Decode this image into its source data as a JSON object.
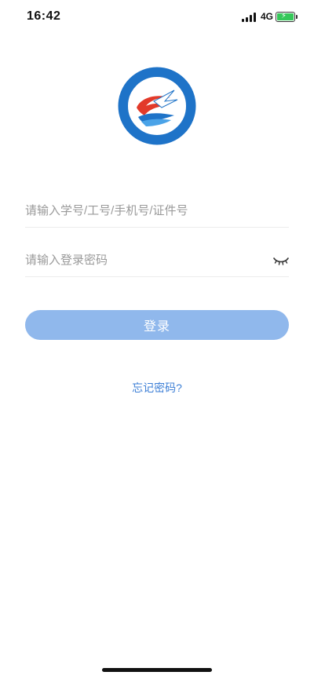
{
  "status_bar": {
    "time": "16:42",
    "network": "4G",
    "battery_icon": "battery-charging-icon",
    "signal_icon": "signal-icon"
  },
  "logo": {
    "icon": "college-logo-icon",
    "colors": {
      "blue": "#1e73c8",
      "red": "#e23a2a",
      "white": "#ffffff"
    }
  },
  "form": {
    "username_placeholder": "请输入学号/工号/手机号/证件号",
    "password_placeholder": "请输入登录密码",
    "toggle_visibility_icon": "eye-closed-icon"
  },
  "login_button": {
    "label": "登录",
    "color": "#90b8ec"
  },
  "forgot_password": {
    "label": "忘记密码?",
    "color": "#3d7fd6"
  }
}
